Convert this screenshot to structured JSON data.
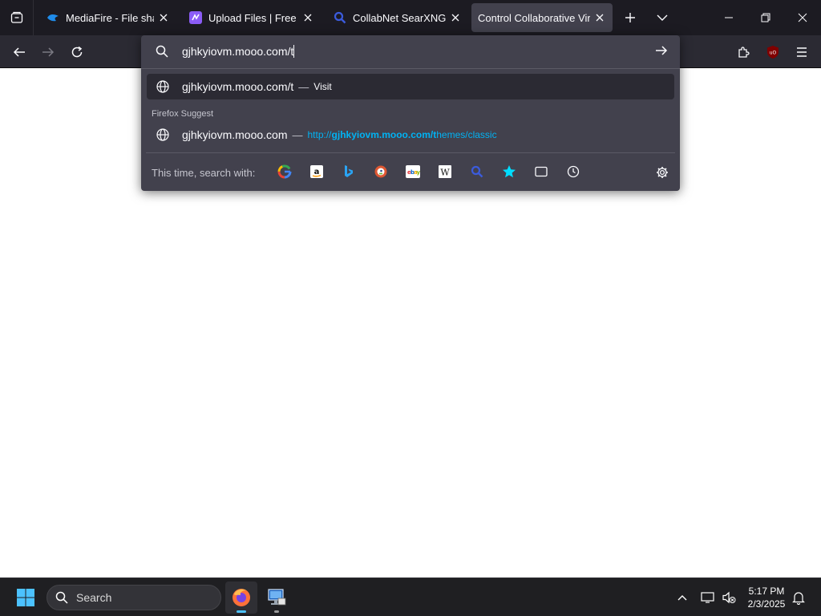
{
  "browser": {
    "tabs": [
      {
        "title": "MediaFire - File sharing",
        "favicon": "mediafire-icon",
        "active": false
      },
      {
        "title": "Upload Files | Free File H",
        "favicon": "upload-icon",
        "active": false
      },
      {
        "title": "CollabNet SearXNG",
        "favicon": "search-icon",
        "active": false
      },
      {
        "title": "Control Collaborative Virtua",
        "favicon": "none",
        "active": true
      }
    ]
  },
  "urlbar": {
    "value": "gjhkyiovm.mooo.com/t",
    "heuristic": {
      "text": "gjhkyiovm.mooo.com/t",
      "dash": "—",
      "action": "Visit"
    },
    "group_label": "Firefox Suggest",
    "suggestion": {
      "title": "gjhkyiovm.mooo.com",
      "dash": "—",
      "url_prefix": "http://",
      "url_bold": "gjhkyiovm.mooo.com/t",
      "url_rest": "hemes/classic"
    },
    "oneoff_label": "This time, search with:",
    "engines": [
      "google",
      "amazon",
      "bing",
      "duckduckgo",
      "ebay",
      "wikipedia",
      "searxng",
      "bookmarks",
      "tabs",
      "history"
    ]
  },
  "taskbar": {
    "search_label": "Search",
    "time": "5:17 PM",
    "date": "2/3/2025"
  },
  "colors": {
    "tab_strip": "#1c1b22",
    "toolbar": "#2b2a33",
    "panel": "#42414d",
    "link": "#00b3f4"
  }
}
